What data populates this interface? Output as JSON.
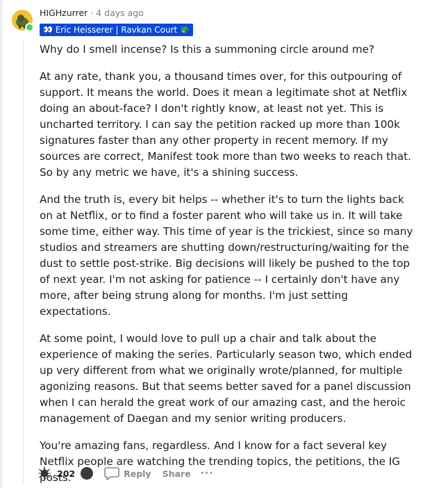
{
  "comment": {
    "author": "HIGHzurrer",
    "separator": "·",
    "timestamp": "4 days ago",
    "flair": {
      "left_emoji": "👀",
      "text": "Eric Heisserer | Ravkan Court",
      "right_emoji": "🐲",
      "color": "#0a49d8"
    },
    "paragraphs": [
      "Why do I smell incense? Is this a summoning circle around me?",
      "At any rate, thank you, a thousand times over, for this outpouring of support. It means the world. Does it mean a legitimate shot at Netflix doing an about-face? I don't rightly know, at least not yet. This is uncharted territory. I can say the petition racked up more than 100k signatures faster than any other property in recent memory. If my sources are correct, Manifest took more than two weeks to reach that. So by any metric we have, it's a shining success.",
      "And the truth is, every bit helps -- whether it's to turn the lights back on at Netflix, or to find a foster parent who will take us in. It will take some time, either way. This time of year is the trickiest, since so many studios and streamers are shutting down/restructuring/waiting for the dust to settle post-strike. Big decisions will likely be pushed to the top of next year. I'm not asking for patience -- I certainly don't have any more, after being strung along for months. I'm just setting expectations.",
      "At some point, I would love to pull up a chair and talk about the experience of making the series. Particularly season two, which ended up very different from what we originally wrote/planned, for multiple agonizing reasons. But that seems better saved for a panel discussion when I can herald the great work of our amazing cast, and the heroic management of Daegan and my senior writing producers.",
      "You're amazing fans, regardless. And I know for a fact several key Netflix people are watching the trending topics, the petitions, the IG posts."
    ],
    "actions": {
      "score": "202",
      "reply_label": "Reply",
      "share_label": "Share",
      "more_label": "···"
    },
    "icons": {
      "avatar": "avatar-icon",
      "upvote": "award-upvote-icon",
      "downvote": "downvote-icon",
      "reply": "comment-bubble-icon"
    },
    "colors": {
      "online": "#46d160",
      "avatar_bg": "#f2c232"
    }
  }
}
